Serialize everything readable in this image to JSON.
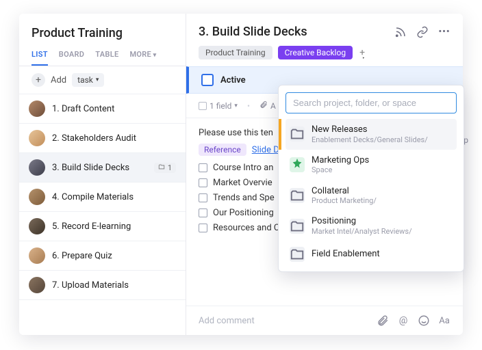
{
  "sidebar": {
    "title": "Product Training",
    "tabs": [
      "LIST",
      "BOARD",
      "TABLE",
      "MORE"
    ],
    "active_tab_index": 0,
    "add_label": "Add",
    "add_task_pill": "task",
    "tasks": [
      {
        "label": "1. Draft Content"
      },
      {
        "label": "2. Stakeholders Audit"
      },
      {
        "label": "3. Build Slide Decks",
        "selected": true,
        "folder_count": "1"
      },
      {
        "label": "4. Compile Materials"
      },
      {
        "label": "5. Record E-learning"
      },
      {
        "label": "6. Prepare Quiz"
      },
      {
        "label": "7. Upload Materials"
      }
    ]
  },
  "main": {
    "title": "3. Build Slide Decks",
    "tags": [
      {
        "label": "Product Training",
        "style": "grey"
      },
      {
        "label": "Creative Backlog",
        "style": "purple"
      }
    ],
    "status": {
      "label": "Active"
    },
    "meta": {
      "fields": "1 field",
      "attachments": "A"
    },
    "body": {
      "intro": "Please use this ten",
      "reference_tag": "Reference",
      "reference_link": "Slide D",
      "checklist": [
        "Course Intro an",
        "Market Overvie",
        "Trends and Spe",
        "Our Positioning",
        "Resources and Contacts"
      ]
    },
    "comment_placeholder": "Add comment",
    "truncated_right": "up"
  },
  "popover": {
    "search_placeholder": "Search project, folder, or space",
    "items": [
      {
        "title": "New Releases",
        "sub": "Enablement Decks/General Slides/",
        "icon": "folder",
        "active": true
      },
      {
        "title": "Marketing Ops",
        "sub": "Space",
        "icon": "space-green"
      },
      {
        "title": "Collateral",
        "sub": "Product Marketing/",
        "icon": "folder"
      },
      {
        "title": "Positioning",
        "sub": "Market Intel/Analyst Reviews/",
        "icon": "folder"
      },
      {
        "title": "Field Enablement",
        "sub": "",
        "icon": "folder"
      }
    ]
  }
}
